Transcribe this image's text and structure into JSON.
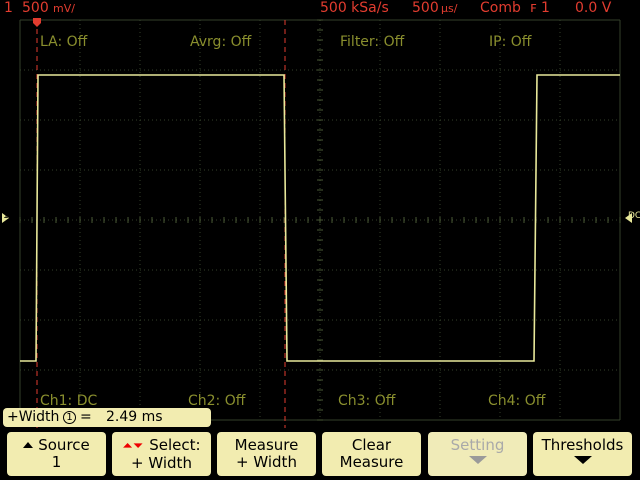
{
  "topbar": {
    "channel_num": "1",
    "volts_div": "500",
    "volts_unit": "mV/",
    "sample_rate": "500 kSa/s",
    "time_div": "500",
    "time_unit": "µs/",
    "trigger_mode": "Comb",
    "trigger_source": "1",
    "trigger_level": "0.0 V"
  },
  "overlays": {
    "la": "LA: Off",
    "avrg": "Avrg: Off",
    "filter": "Filter: Off",
    "ip": "IP: Off",
    "ch1": "Ch1: DC",
    "ch2": "Ch2: Off",
    "ch3": "Ch3: Off",
    "ch4": "Ch4: Off"
  },
  "markers": {
    "left_ground": "1",
    "right_label": "DC"
  },
  "measurement": {
    "label": "+Width",
    "source_marker": "1",
    "equals": "=",
    "value": "2.49 ms"
  },
  "softkeys": [
    {
      "line1": "Source",
      "line2": "1",
      "enabled": true
    },
    {
      "line1": "Select:",
      "line2": "+ Width",
      "enabled": true
    },
    {
      "line1": "Measure",
      "line2": "+ Width",
      "enabled": true
    },
    {
      "line1": "Clear",
      "line2": "Measure",
      "enabled": true
    },
    {
      "line1": "Setting",
      "line2": "",
      "enabled": false
    },
    {
      "line1": "Thresholds",
      "line2": "",
      "enabled": true
    }
  ],
  "colors": {
    "trace": "#e8e89a",
    "grid": "#3c4a2c",
    "cursor": "#e23c2f",
    "label": "#8a8f2e"
  }
}
